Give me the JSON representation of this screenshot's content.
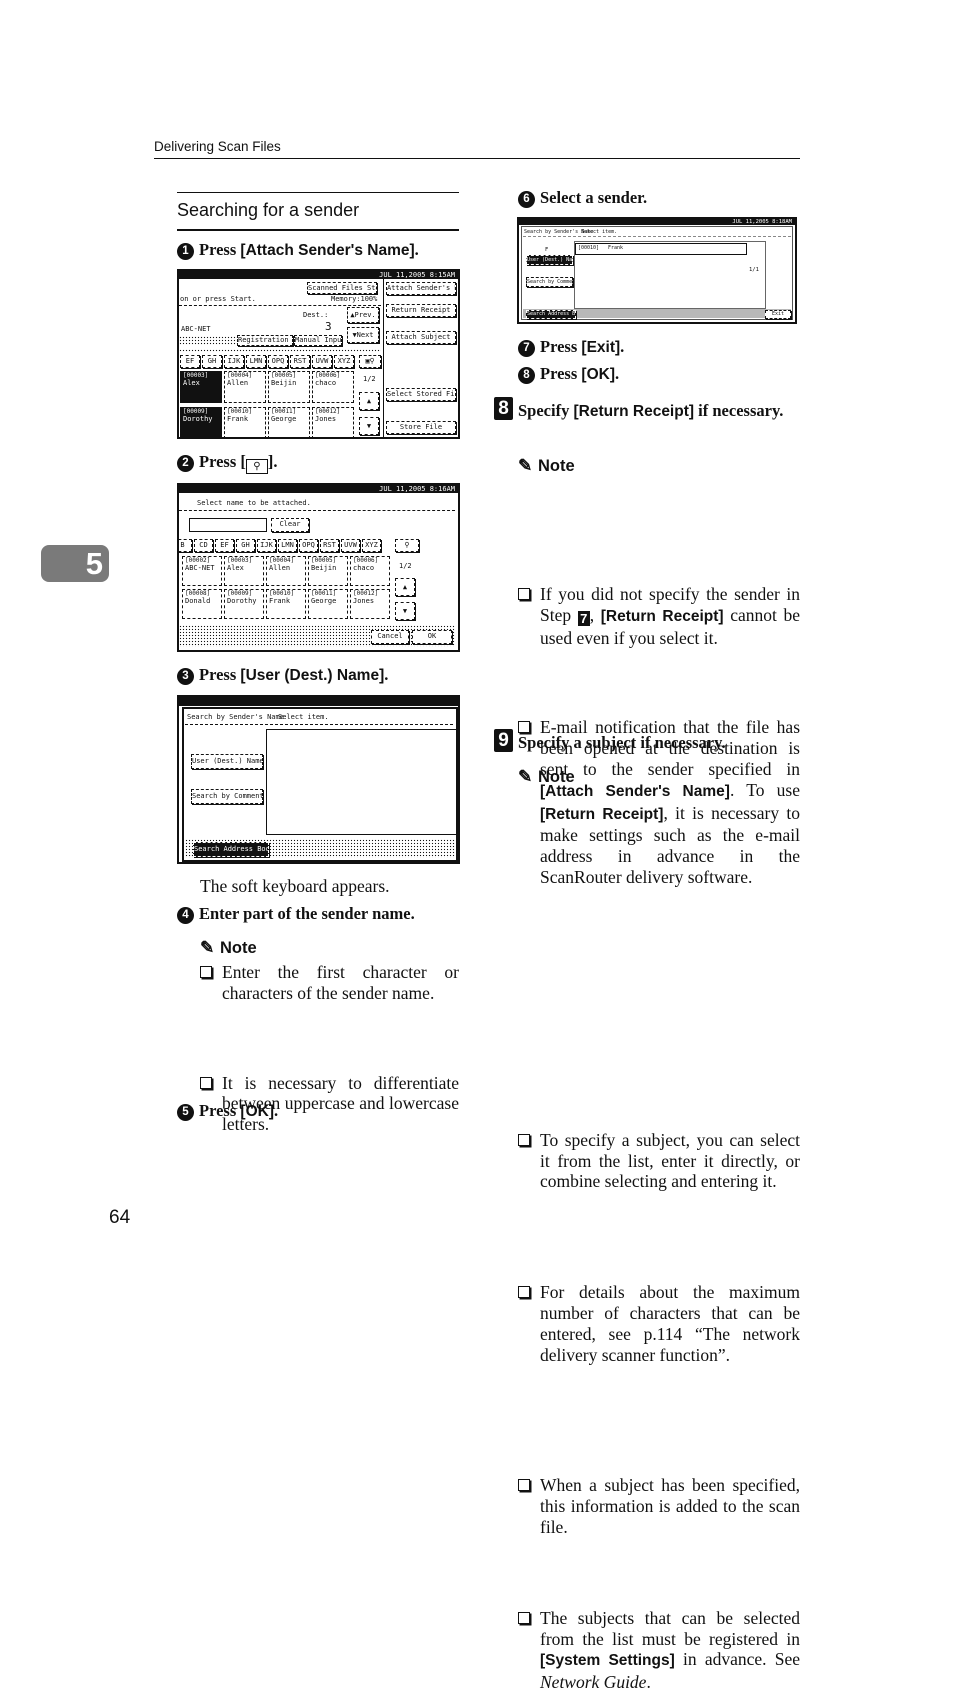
{
  "header": {
    "running_title": "Delivering Scan Files",
    "page_number": "64",
    "chapter_tab": "5"
  },
  "section": {
    "title": "Searching for a sender"
  },
  "left_column": {
    "step1": {
      "num": "1",
      "prefix": "Press ",
      "key": "[Attach Sender's Name]",
      "suffix": "."
    },
    "step2": {
      "num": "2",
      "prefix": "Press [",
      "icon": "search-address-icon",
      "suffix": "]."
    },
    "step3": {
      "num": "3",
      "prefix": "Press ",
      "key": "[User (Dest.) Name]",
      "suffix": "."
    },
    "after_step3": "The soft keyboard appears.",
    "step4": {
      "num": "4",
      "text": "Enter part of the sender name."
    },
    "note4": {
      "title": "Note",
      "items": [
        "Enter the first character or characters of the sender name.",
        "It is necessary to differentiate between uppercase and lowercase letters."
      ]
    },
    "step5": {
      "num": "5",
      "prefix": "Press ",
      "key": "[OK]",
      "suffix": "."
    }
  },
  "right_column": {
    "step6": {
      "num": "6",
      "text": "Select a sender."
    },
    "step7": {
      "num": "7",
      "prefix": "Press ",
      "key": "[Exit]",
      "suffix": "."
    },
    "step8": {
      "num": "8",
      "prefix": "Press ",
      "key": "[OK]",
      "suffix": "."
    },
    "big8": {
      "num": "8",
      "prefix": "Specify ",
      "key": "[Return Receipt]",
      "suffix": " if necessary.",
      "note": {
        "title": "Note",
        "item1": {
          "a": "If you did not specify the sender in Step ",
          "step_ref": "7",
          "b": ", ",
          "key": "[Return Receipt]",
          "c": " cannot be used even if you select it."
        },
        "item2": {
          "a": "E-mail notification that the file has been opened at the destination is sent to the sender specified in ",
          "key1": "[Attach Sender's Name]",
          "b": ". To use ",
          "key2": "[Return Receipt]",
          "c": ", it is necessary to make settings such as the e-mail address in advance in the ScanRouter delivery software."
        }
      }
    },
    "big9": {
      "num": "9",
      "text": "Specify a subject if necessary.",
      "note": {
        "title": "Note",
        "item1": "To specify a subject, you can select it from the list, enter it directly, or combine selecting and entering it.",
        "item2": "For details about the maximum number of characters that can be entered, see p.114 “The network delivery scanner function”.",
        "item3": "When a subject has been specified, this information is added to the scan file.",
        "item4": {
          "a": "The subjects that can be selected from the list must be registered in ",
          "key": "[System Settings]",
          "b": " in advance. See ",
          "ref": "Network Guide",
          "c": "."
        }
      }
    }
  },
  "screen1": {
    "datetime": "JUL  11,2005  8:15AM",
    "scanned_files_status": "Scanned Files Status",
    "message": "on or press Start.",
    "memory": "Memory:100%",
    "dest_label": "Dest.:",
    "dest_count": "3",
    "dest_name": "ABC-NET",
    "registration_no": "Registration No.",
    "manual_input": "Manual Input",
    "prev": "▲Prev.",
    "next": "▼Next",
    "right_buttons": [
      "Attach Sender's Name",
      "Return Receipt",
      "Attach Subject",
      "Select Stored File",
      "Store File"
    ],
    "index_tabs": [
      "EF",
      "GH",
      "IJK",
      "LMN",
      "OPQ",
      "RST",
      "UVW",
      "XYZ"
    ],
    "page": "1/2",
    "entries": [
      {
        "code": "[00003]",
        "name": "Alex",
        "selected": true
      },
      {
        "code": "[00004]",
        "name": "Allen",
        "selected": false
      },
      {
        "code": "[00005]",
        "name": "Beijin",
        "selected": false
      },
      {
        "code": "[00006]",
        "name": "chaco",
        "selected": false
      },
      {
        "code": "[00009]",
        "name": "Dorothy",
        "selected": true
      },
      {
        "code": "[00010]",
        "name": "Frank",
        "selected": false
      },
      {
        "code": "[00011]",
        "name": "George",
        "selected": false
      },
      {
        "code": "[00012]",
        "name": "Jones",
        "selected": false
      }
    ]
  },
  "screen2": {
    "datetime": "JUL  11,2005  8:16AM",
    "instruction": "Select name to be attached.",
    "clear": "Clear",
    "index_tabs": [
      "B",
      "CD",
      "EF",
      "GH",
      "IJK",
      "LMN",
      "OPQ",
      "RST",
      "UVW",
      "XYZ"
    ],
    "page": "1/2",
    "entries": [
      {
        "code": "[00002]",
        "name": "ABC-NET"
      },
      {
        "code": "[00003]",
        "name": "Alex"
      },
      {
        "code": "[00004]",
        "name": "Allen"
      },
      {
        "code": "[00005]",
        "name": "Beijin"
      },
      {
        "code": "[00006]",
        "name": "chaco"
      },
      {
        "code": "[00008]",
        "name": "Donald"
      },
      {
        "code": "[00009]",
        "name": "Dorothy"
      },
      {
        "code": "[00010]",
        "name": "Frank"
      },
      {
        "code": "[00011]",
        "name": "George"
      },
      {
        "code": "[00012]",
        "name": "Jones"
      }
    ],
    "cancel": "Cancel",
    "ok": "OK"
  },
  "screen3": {
    "tab": "Search by Sender's Name",
    "instruction": "Select item.",
    "user_dest_name": "User (Dest.) Name",
    "search_by_comment": "Search by Comment",
    "search_address_book": "Search Address Book"
  },
  "screen4": {
    "datetime": "JUL  11,2005  8:18AM",
    "tab": "Search by Sender's Name",
    "instruction": "Select item.",
    "typed": "F",
    "user_dest_name": "User (Dest.) Name",
    "search_by_comment": "Search by Comment",
    "result_code": "[00010]",
    "result_name": "Frank",
    "page": "1/1",
    "search_address_book": "Search Address Book",
    "exit": "Exit"
  }
}
